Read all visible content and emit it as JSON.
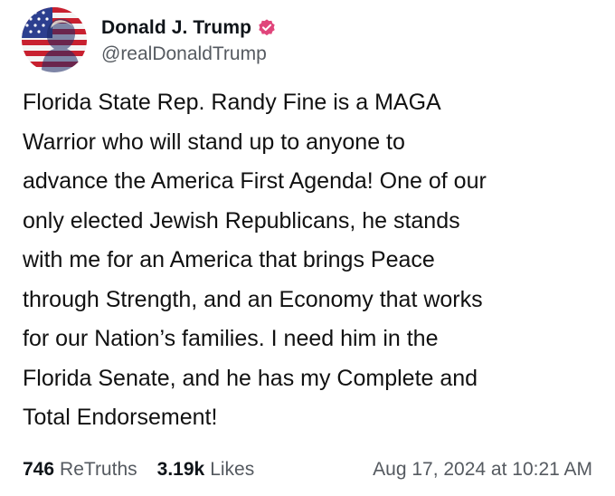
{
  "author": {
    "display_name": "Donald J. Trump",
    "handle": "@realDonaldTrump",
    "verified_color": "#e0457b",
    "avatar_icon": "american-flag-portrait"
  },
  "post": {
    "text": "Florida State Rep. Randy Fine is a MAGA\nWarrior who will stand up to anyone to\nadvance the America First Agenda! One of our\nonly elected Jewish Republicans, he stands\nwith me for an America that brings Peace\nthrough Strength, and an Economy that works\nfor our Nation’s families. I need him in the\nFlorida Senate, and he has my Complete and\nTotal Endorsement!"
  },
  "stats": {
    "retruths_count": "746",
    "retruths_label": "ReTruths",
    "likes_count": "3.19k",
    "likes_label": "Likes",
    "timestamp": "Aug 17, 2024 at 10:21 AM"
  }
}
